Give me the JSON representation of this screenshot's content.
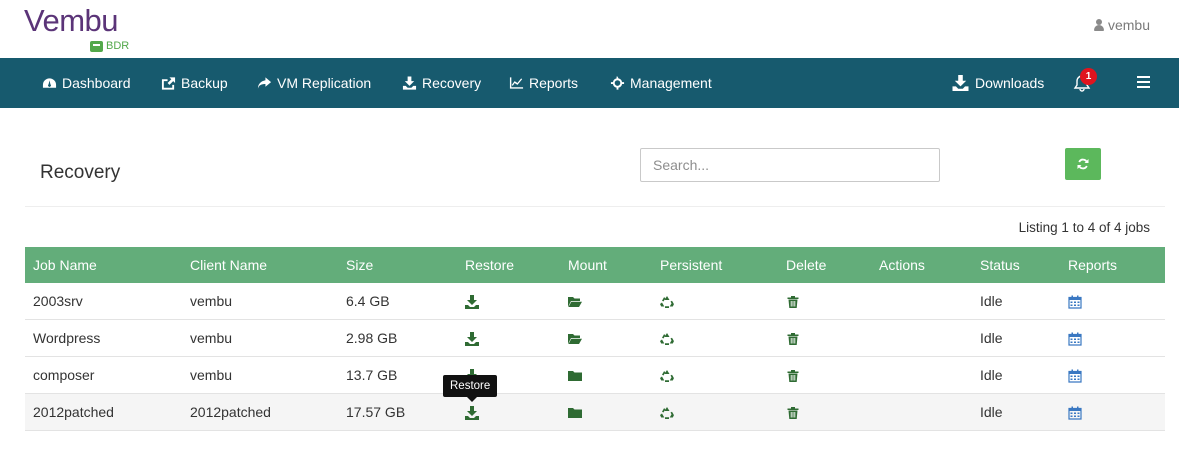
{
  "brand": {
    "logo_text": "Vembu",
    "logo_sub": "BDR"
  },
  "user": {
    "name": "vembu"
  },
  "nav": {
    "dashboard": "Dashboard",
    "backup": "Backup",
    "vm_replication": "VM Replication",
    "recovery": "Recovery",
    "reports": "Reports",
    "management": "Management",
    "downloads": "Downloads",
    "notification_count": "1"
  },
  "page": {
    "title": "Recovery",
    "search_placeholder": "Search...",
    "listing": "Listing 1 to 4 of 4 jobs"
  },
  "table": {
    "columns": [
      "Job Name",
      "Client Name",
      "Size",
      "Restore",
      "Mount",
      "Persistent",
      "Delete",
      "Actions",
      "Status",
      "Reports"
    ],
    "rows": [
      {
        "job": "2003srv",
        "client": "vembu",
        "size": "6.4 GB",
        "status": "Idle",
        "mount_icon": "folder-open-icon"
      },
      {
        "job": "Wordpress",
        "client": "vembu",
        "size": "2.98 GB",
        "status": "Idle",
        "mount_icon": "folder-open-icon"
      },
      {
        "job": "composer",
        "client": "vembu",
        "size": "13.7 GB",
        "status": "Idle",
        "mount_icon": "folder-icon"
      },
      {
        "job": "2012patched",
        "client": "2012patched",
        "size": "17.57 GB",
        "status": "Idle",
        "mount_icon": "folder-icon"
      }
    ]
  },
  "tooltip": {
    "text": "Restore"
  },
  "colors": {
    "nav_bg": "#175a6e",
    "table_header": "#63ad7a",
    "icon_green": "#2f6b33",
    "icon_blue": "#3a78c2",
    "refresh": "#5cb85c",
    "badge": "#e0141e"
  }
}
